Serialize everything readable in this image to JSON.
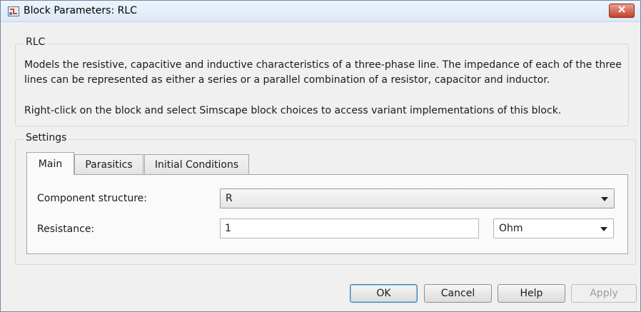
{
  "window": {
    "title": "Block Parameters: RLC"
  },
  "block_group": {
    "label": "RLC",
    "description_1": "Models the resistive, capacitive and inductive characteristics of a three-phase line. The impedance of each of the three lines can be represented as either a series or a parallel combination of a resistor, capacitor and inductor.",
    "description_2": "Right-click on the block and select Simscape block choices to access variant implementations of this block."
  },
  "settings": {
    "label": "Settings",
    "tabs": [
      {
        "label": "Main",
        "active": true
      },
      {
        "label": "Parasitics",
        "active": false
      },
      {
        "label": "Initial Conditions",
        "active": false
      }
    ],
    "main": {
      "component_structure_label": "Component structure:",
      "component_structure_value": "R",
      "resistance_label": "Resistance:",
      "resistance_value": "1",
      "resistance_unit": "Ohm"
    }
  },
  "buttons": {
    "ok": "OK",
    "cancel": "Cancel",
    "help": "Help",
    "apply": "Apply"
  },
  "icons": {
    "title": "simulink-block-icon",
    "close": "close-icon",
    "dropdown": "chevron-down-icon"
  },
  "colors": {
    "close_button": "#c7412b",
    "default_button_border": "#3c7fb1",
    "dialog_background": "#f0f0f0"
  }
}
